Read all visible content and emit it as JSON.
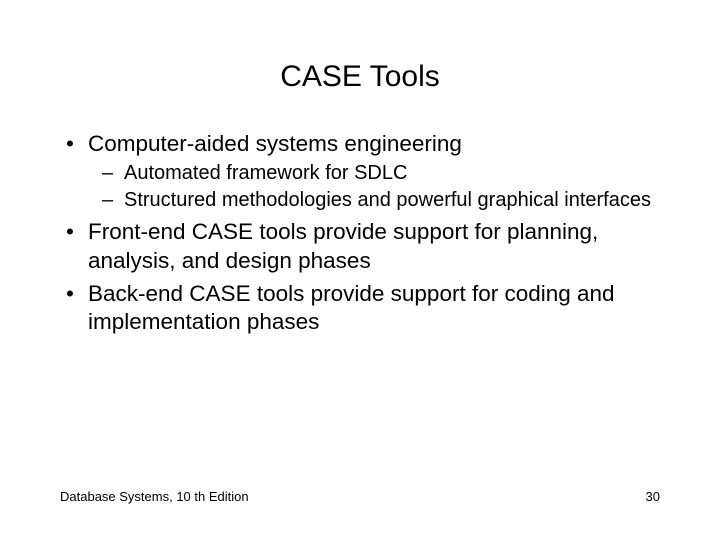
{
  "title": "CASE Tools",
  "bullets": {
    "b0": "Computer-aided systems engineering",
    "b0_sub0": "Automated framework for SDLC",
    "b0_sub1": "Structured methodologies and powerful graphical interfaces",
    "b1": "Front-end CASE tools provide support for planning, analysis, and design phases",
    "b2": "Back-end CASE tools provide support for coding and implementation phases"
  },
  "footer": {
    "left": "Database Systems, 10 th Edition",
    "right": "30"
  }
}
